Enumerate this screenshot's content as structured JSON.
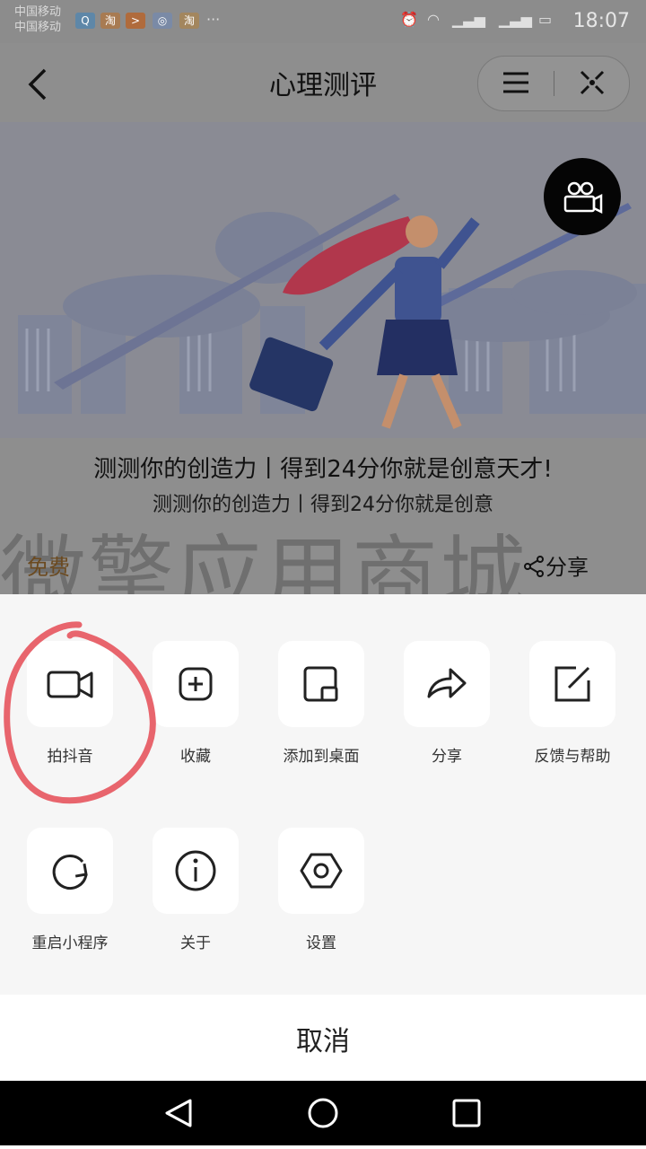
{
  "status_bar": {
    "carrier_1": "中国移动",
    "carrier_2": "中国移动",
    "time": "18:07"
  },
  "nav": {
    "title": "心理测评"
  },
  "content": {
    "headline": "测测你的创造力丨得到24分你就是创意天才!",
    "subline": "测测你的创造力丨得到24分你就是创意",
    "price": "免费",
    "share_label": "分享",
    "watermark": "微擎应用商城"
  },
  "actions": [
    {
      "label": "拍抖音",
      "icon": "video-camera-icon"
    },
    {
      "label": "收藏",
      "icon": "add-favorite-icon"
    },
    {
      "label": "添加到桌面",
      "icon": "add-to-desktop-icon"
    },
    {
      "label": "分享",
      "icon": "share-arrow-icon"
    },
    {
      "label": "反馈与帮助",
      "icon": "feedback-edit-icon"
    },
    {
      "label": "重启小程序",
      "icon": "restart-icon"
    },
    {
      "label": "关于",
      "icon": "info-icon"
    },
    {
      "label": "设置",
      "icon": "settings-hexagon-icon"
    }
  ],
  "cancel_label": "取消",
  "colors": {
    "overlay_gray": "#8e8e8e",
    "sheet_bg": "#f6f6f6",
    "annotation_red": "#e8656d",
    "price_brown": "#6b4a20"
  }
}
